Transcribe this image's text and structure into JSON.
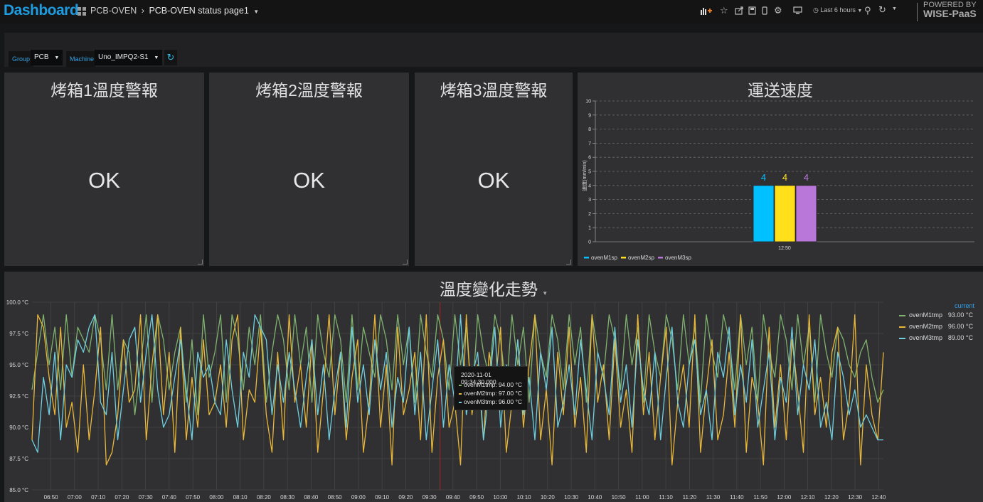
{
  "header": {
    "brand": "Dashboard",
    "folder": "PCB-OVEN",
    "page": "PCB-OVEN status page1",
    "time_range": "Last 6 hours",
    "logo_line1": "POWERED BY",
    "logo_line2": "WISE-PaaS"
  },
  "variables": {
    "group_label": "Group",
    "group_value": "PCB",
    "machine_label": "Machine",
    "machine_value": "Uno_IMPQ2-S1"
  },
  "alerts": [
    {
      "title": "烤箱1溫度警報",
      "value": "OK"
    },
    {
      "title": "烤箱2溫度警報",
      "value": "OK"
    },
    {
      "title": "烤箱3溫度警報",
      "value": "OK"
    }
  ],
  "speed_panel": {
    "title": "運送速度"
  },
  "trend_panel": {
    "title": "溫度變化走勢"
  },
  "legend": {
    "current_label": "current",
    "items": [
      {
        "name": "ovenM1tmp",
        "value": "93.00 °C"
      },
      {
        "name": "ovenM2tmp",
        "value": "96.00 °C"
      },
      {
        "name": "ovenM3tmp",
        "value": "89.00 °C"
      }
    ]
  },
  "tooltip": {
    "time": "2020-11-01 09:34:30.000",
    "rows": [
      {
        "name": "ovenM1tmp:",
        "value": "94.00 °C"
      },
      {
        "name": "ovenM2tmp:",
        "value": "97.00 °C"
      },
      {
        "name": "ovenM3tmp:",
        "value": "96.00 °C"
      }
    ]
  },
  "colors": {
    "accent": "#1f9ce0",
    "m1": "#7eb26d",
    "m2": "#eab839",
    "m3": "#6ed0e0",
    "bar1": "#00c0ff",
    "bar2": "#ffe01a",
    "bar3": "#b877d9"
  },
  "chart_data": [
    {
      "type": "bar",
      "categories": [
        "12:50"
      ],
      "series": [
        {
          "name": "ovenM1sp",
          "values": [
            4
          ]
        },
        {
          "name": "ovenM2sp",
          "values": [
            4
          ]
        },
        {
          "name": "ovenM3sp",
          "values": [
            4
          ]
        }
      ],
      "ylabel": "速度(mm/min)",
      "ylim": [
        0,
        10
      ],
      "yticks": [
        0,
        1,
        2,
        3,
        4,
        5,
        6,
        7,
        8,
        9,
        10
      ],
      "grid": true,
      "legend_position": "bottom-left"
    },
    {
      "type": "line",
      "ylim": [
        85,
        100
      ],
      "yticks": [
        "85.0 °C",
        "87.5 °C",
        "90.0 °C",
        "92.5 °C",
        "95.0 °C",
        "97.5 °C",
        "100.0 °C"
      ],
      "ytick_values": [
        85,
        87.5,
        90,
        92.5,
        95,
        97.5,
        100
      ],
      "x_start": "06:42",
      "x_end": "12:42",
      "xticks": [
        "06:50",
        "07:00",
        "07:10",
        "07:20",
        "07:30",
        "07:40",
        "07:50",
        "08:00",
        "08:10",
        "08:20",
        "08:30",
        "08:40",
        "08:50",
        "09:00",
        "09:10",
        "09:20",
        "09:30",
        "09:40",
        "09:50",
        "10:00",
        "10:10",
        "10:20",
        "10:30",
        "10:40",
        "10:50",
        "11:00",
        "11:10",
        "11:20",
        "11:30",
        "11:40",
        "11:50",
        "12:00",
        "12:10",
        "12:20",
        "12:30",
        "12:40"
      ],
      "grid": true,
      "legend_position": "right",
      "series": [
        {
          "name": "ovenM1tmp",
          "values": [
            93,
            96,
            99,
            95,
            98,
            93,
            99,
            94,
            98,
            97,
            96,
            99,
            97,
            93,
            99,
            93,
            97,
            96,
            91,
            95,
            99,
            92,
            99,
            97,
            93,
            96,
            98,
            92,
            97,
            91,
            99,
            94,
            96,
            99,
            92,
            99,
            97,
            93,
            98,
            95,
            99,
            92,
            96,
            99,
            97,
            93,
            99,
            95,
            98,
            92,
            99,
            96,
            94,
            99,
            97,
            92,
            99,
            93,
            98,
            96,
            94,
            99,
            97,
            93,
            99,
            95,
            98,
            92,
            99,
            96,
            94,
            99,
            97,
            93,
            99,
            95,
            98,
            92,
            99,
            96,
            94,
            99,
            97,
            93,
            99,
            95,
            98,
            92,
            99,
            96,
            94,
            99,
            97,
            93,
            99,
            95,
            98,
            92,
            99,
            96,
            94,
            99,
            97,
            93,
            99,
            95,
            98,
            92,
            99,
            96,
            94,
            99,
            97,
            93,
            99,
            95,
            98,
            92,
            99,
            96,
            94,
            99,
            97,
            93,
            99,
            95,
            98,
            92,
            99,
            96,
            94,
            99,
            97,
            93,
            99,
            95,
            98,
            92,
            99,
            96,
            94,
            98,
            97,
            95,
            94,
            96,
            97,
            94,
            92,
            93
          ]
        },
        {
          "name": "ovenM2tmp",
          "values": [
            89,
            99,
            98,
            94,
            91,
            98,
            90,
            92,
            88,
            95,
            89,
            93,
            98,
            87,
            88,
            91,
            97,
            92,
            93,
            99,
            89,
            95,
            99,
            91,
            96,
            88,
            98,
            89,
            94,
            90,
            97,
            91,
            92,
            95,
            90,
            97,
            99,
            89,
            93,
            92,
            98,
            91,
            88,
            96,
            89,
            99,
            92,
            95,
            90,
            97,
            88,
            93,
            99,
            91,
            96,
            89,
            94,
            97,
            88,
            92,
            99,
            90,
            95,
            87,
            98,
            91,
            93,
            96,
            89,
            99,
            88,
            94,
            97,
            90,
            92,
            87,
            99,
            91,
            95,
            89,
            96,
            93,
            98,
            88,
            92,
            97,
            90,
            95,
            99,
            89,
            93,
            87,
            96,
            91,
            98,
            90,
            94,
            88,
            99,
            92,
            95,
            89,
            97,
            90,
            93,
            88,
            99,
            91,
            96,
            89,
            94,
            98,
            87,
            92,
            95,
            90,
            99,
            88,
            93,
            97,
            89,
            91,
            96,
            90,
            99,
            88,
            94,
            92,
            87,
            98,
            90,
            95,
            89,
            97,
            93,
            88,
            99,
            91,
            94,
            90,
            96,
            98,
            89,
            92,
            99,
            87,
            95,
            91,
            89,
            96
          ]
        },
        {
          "name": "ovenM3tmp",
          "values": [
            89,
            88,
            94,
            91,
            96,
            89,
            95,
            94,
            97,
            96,
            98,
            99,
            92,
            91,
            96,
            89,
            93,
            97,
            98,
            92,
            96,
            99,
            93,
            90,
            91,
            94,
            97,
            93,
            89,
            96,
            94,
            95,
            92,
            91,
            97,
            93,
            90,
            96,
            94,
            99,
            98,
            97,
            91,
            95,
            92,
            96,
            93,
            90,
            94,
            97,
            91,
            95,
            89,
            93,
            96,
            90,
            98,
            92,
            95,
            91,
            97,
            93,
            96,
            90,
            94,
            92,
            98,
            91,
            96,
            89,
            93,
            97,
            90,
            95,
            92,
            99,
            91,
            94,
            96,
            89,
            93,
            98,
            90,
            95,
            92,
            97,
            91,
            94,
            89,
            96,
            93,
            98,
            90,
            92,
            95,
            91,
            97,
            93,
            89,
            96,
            94,
            91,
            98,
            92,
            95,
            90,
            97,
            93,
            91,
            96,
            89,
            94,
            98,
            92,
            90,
            95,
            97,
            91,
            93,
            89,
            96,
            94,
            98,
            91,
            95,
            92,
            97,
            90,
            93,
            96,
            89,
            94,
            92,
            98,
            91,
            95,
            93,
            97,
            90,
            92,
            89,
            96,
            94,
            91,
            93,
            90,
            91,
            90,
            89,
            89
          ]
        }
      ]
    }
  ]
}
